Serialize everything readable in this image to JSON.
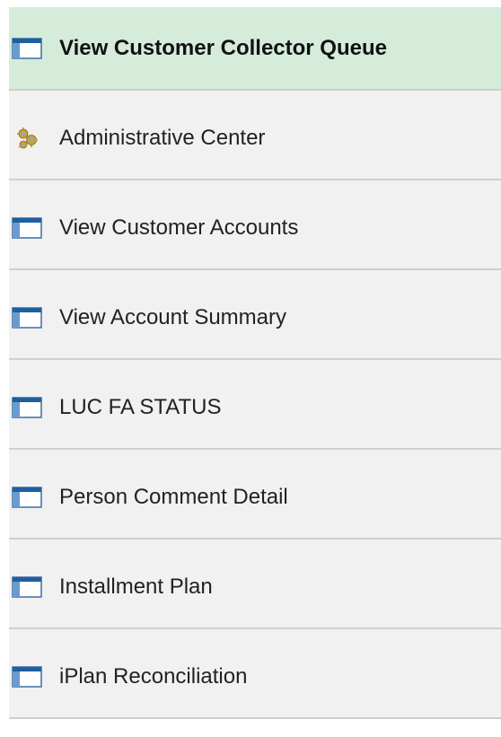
{
  "nav": {
    "items": [
      {
        "label": "View Customer Collector Queue",
        "icon": "component-window-icon",
        "selected": true
      },
      {
        "label": "Administrative Center",
        "icon": "gear-cluster-icon",
        "selected": false
      },
      {
        "label": "View Customer Accounts",
        "icon": "component-window-icon",
        "selected": false
      },
      {
        "label": "View Account Summary",
        "icon": "component-window-icon",
        "selected": false
      },
      {
        "label": "LUC FA STATUS",
        "icon": "component-window-icon",
        "selected": false
      },
      {
        "label": "Person Comment Detail",
        "icon": "component-window-icon",
        "selected": false
      },
      {
        "label": "Installment Plan",
        "icon": "component-window-icon",
        "selected": false
      },
      {
        "label": "iPlan Reconciliation",
        "icon": "component-window-icon",
        "selected": false
      }
    ]
  },
  "colors": {
    "selected_background": "#d5ecdb",
    "item_background": "#f1f1f1",
    "divider": "#cfcfcf",
    "icon_blue": "#1f5f9e"
  }
}
